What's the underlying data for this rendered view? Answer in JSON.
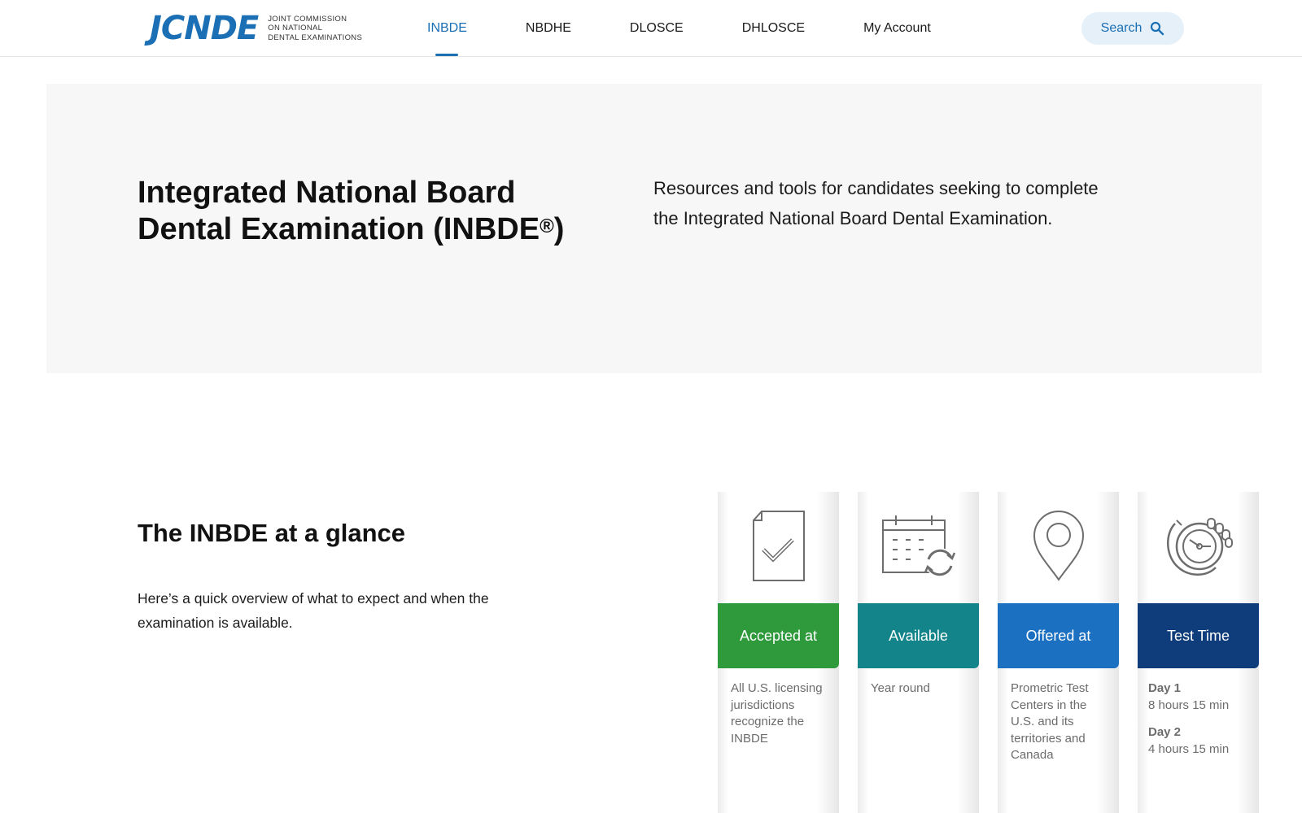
{
  "header": {
    "logo": {
      "mark": "JCNDE",
      "line1": "Joint Commission",
      "line2": "on National",
      "line3": "Dental Examinations"
    },
    "nav": [
      {
        "label": "INBDE",
        "active": true
      },
      {
        "label": "NBDHE",
        "active": false
      },
      {
        "label": "DLOSCE",
        "active": false
      },
      {
        "label": "DHLOSCE",
        "active": false
      },
      {
        "label": "My Account",
        "active": false
      }
    ],
    "search_label": "Search"
  },
  "hero": {
    "title_main": "Integrated National Board Dental Examination (INBDE",
    "title_reg": "®",
    "title_close": ")",
    "description": "Resources and tools for candidates seeking to complete the Integrated National Board Dental Examination."
  },
  "glance": {
    "title": "The INBDE at a glance",
    "description": "Here’s a quick overview of what to expect and when the examination is available."
  },
  "cards": [
    {
      "icon": "document-check-icon",
      "label": "Accepted at",
      "color": "#2e9a3c",
      "text": "All U.S. licensing jurisdictions recognize the INBDE"
    },
    {
      "icon": "calendar-refresh-icon",
      "label": "Available",
      "color": "#138489",
      "text": "Year round"
    },
    {
      "icon": "location-pin-icon",
      "label": "Offered at",
      "color": "#1b70c1",
      "text": "Prometric Test Centers in the U.S. and its territories and Canada"
    },
    {
      "icon": "stopwatch-icon",
      "label": "Test Time",
      "color": "#0f3c7a",
      "days": [
        {
          "day": "Day 1",
          "duration": "8 hours 15 min"
        },
        {
          "day": "Day 2",
          "duration": "4 hours 15 min"
        }
      ]
    }
  ],
  "colors": {
    "brand": "#1a6fb5",
    "search_bg": "#e6f0f8",
    "hero_bg": "#f7f7f7"
  }
}
